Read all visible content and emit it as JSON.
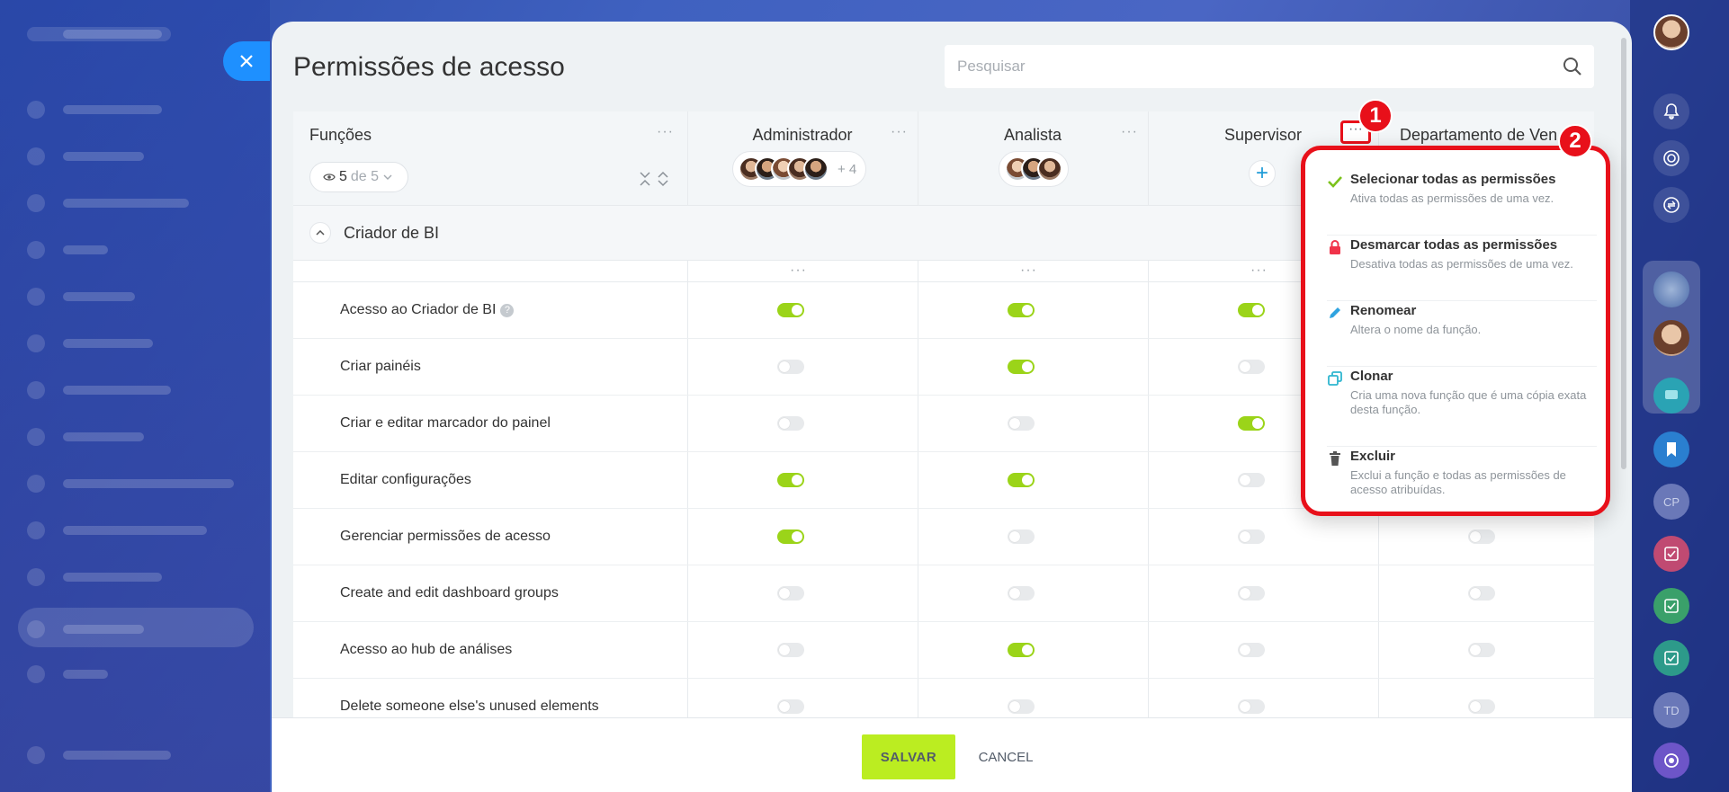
{
  "panel": {
    "title": "Permissões de acesso"
  },
  "search": {
    "placeholder": "Pesquisar"
  },
  "functions": {
    "label": "Funções",
    "counter_shown": "5",
    "counter_total": "de 5"
  },
  "roles": [
    {
      "name": "Administrador",
      "extra": "+ 4"
    },
    {
      "name": "Analista"
    },
    {
      "name": "Supervisor"
    },
    {
      "name": "Departamento de Ven"
    }
  ],
  "section": {
    "title": "Criador de BI"
  },
  "permissions": [
    {
      "label": "Acesso ao Criador de BI",
      "states": [
        "on",
        "on",
        "on",
        "off"
      ]
    },
    {
      "label": "Criar painéis",
      "states": [
        "off",
        "on",
        "off",
        "off"
      ]
    },
    {
      "label": "Criar e editar marcador do painel",
      "states": [
        "off",
        "off",
        "on",
        "off"
      ]
    },
    {
      "label": "Editar configurações",
      "states": [
        "on",
        "on",
        "off",
        "off"
      ]
    },
    {
      "label": "Gerenciar permissões de acesso",
      "states": [
        "on",
        "off",
        "off",
        "off"
      ]
    },
    {
      "label": "Create and edit dashboard groups",
      "states": [
        "off",
        "off",
        "off",
        "off"
      ]
    },
    {
      "label": "Acesso ao hub de análises",
      "states": [
        "off",
        "on",
        "off",
        "off"
      ]
    },
    {
      "label": "Delete someone else's unused elements",
      "states": [
        "off",
        "off",
        "off",
        "off"
      ]
    }
  ],
  "menu": {
    "items": [
      {
        "title": "Selecionar todas as permissões",
        "desc": "Ativa todas as permissões de uma vez.",
        "icon": "check-icon"
      },
      {
        "title": "Desmarcar todas as permissões",
        "desc": "Desativa todas as permissões de uma vez.",
        "icon": "lock-icon"
      },
      {
        "title": "Renomear",
        "desc": "Altera o nome da função.",
        "icon": "pencil-icon"
      },
      {
        "title": "Clonar",
        "desc": "Cria uma nova função que é uma cópia exata desta função.",
        "icon": "copy-icon"
      },
      {
        "title": "Excluir",
        "desc": "Exclui a função e todas as permissões de acesso atribuídas.",
        "icon": "trash-icon"
      }
    ]
  },
  "badges": {
    "first": "1",
    "second": "2"
  },
  "footer": {
    "save_label": "SALVAR",
    "cancel_label": "CANCEL"
  },
  "rail": {
    "initials_1": "CP",
    "initials_2": "TD"
  },
  "colors": {
    "accent": "#bbed21",
    "toggle_on": "#9bd419",
    "highlight": "#e8101a",
    "close": "#1e90ff"
  }
}
